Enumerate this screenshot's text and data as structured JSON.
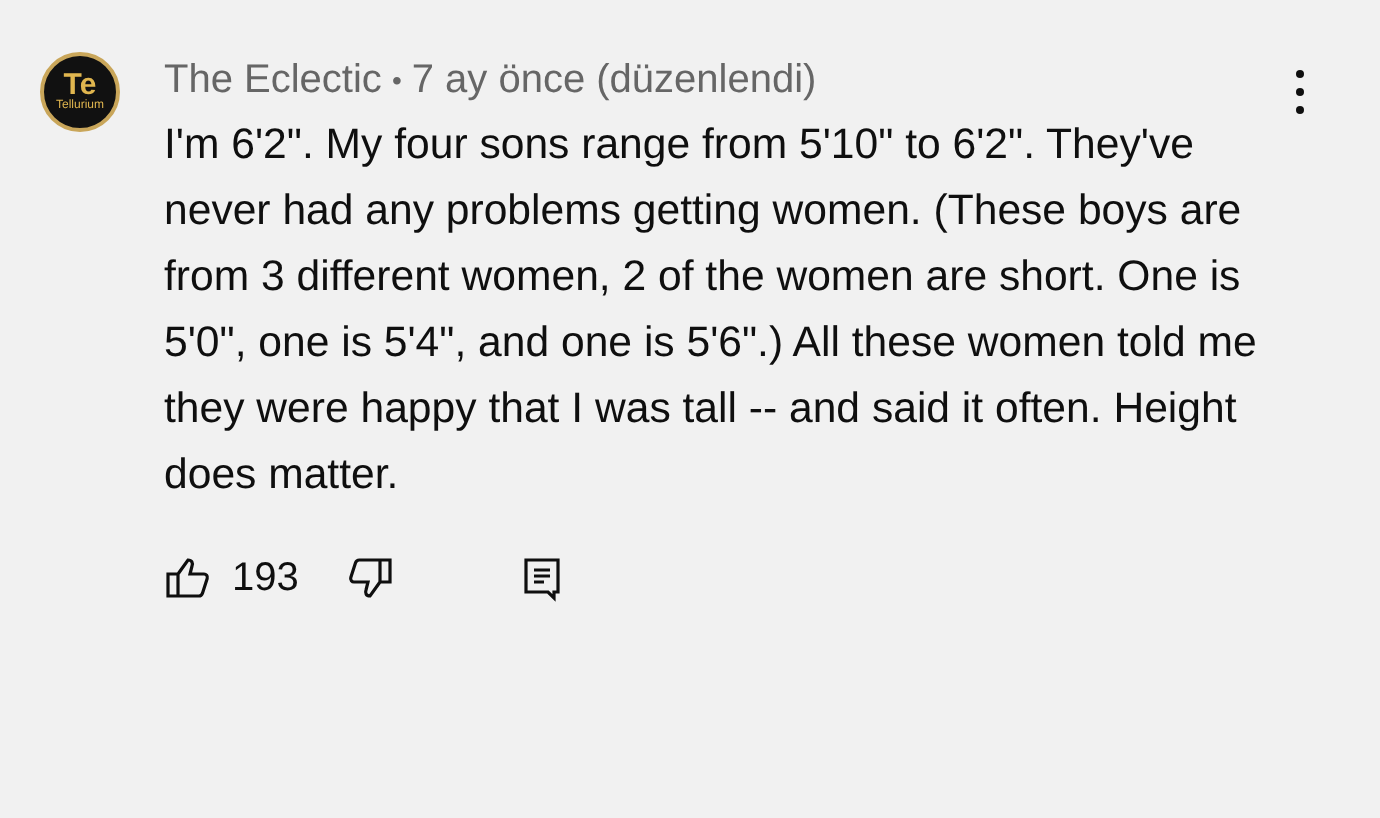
{
  "comment": {
    "avatar": {
      "symbol": "Te",
      "name": "Tellurium"
    },
    "author": "The Eclectic",
    "separator": "•",
    "time": "7 ay önce (düzenlendi)",
    "text": "I'm 6'2\". My four sons range from 5'10\" to 6'2\". They've never had any problems getting women. (These boys are from 3 different women, 2 of the women are short. One is 5'0\", one is 5'4\", and one is 5'6\".) All these women told me they were happy that I was tall -- and said it often. Height does matter.",
    "likes": "193"
  }
}
